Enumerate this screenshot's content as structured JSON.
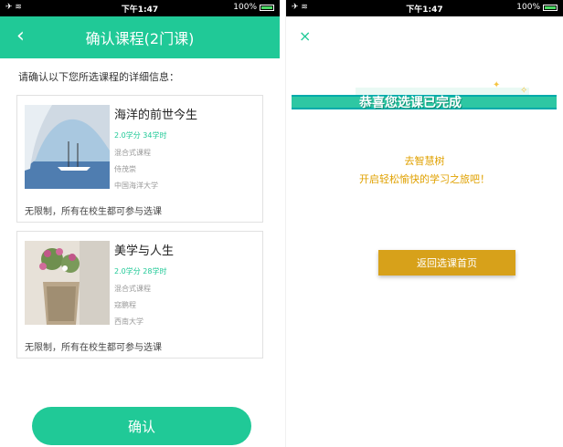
{
  "left": {
    "status": {
      "left": "✈ ≋",
      "time": "下午1:47",
      "battery": "100%"
    },
    "nav": {
      "back": "‹",
      "title": "确认课程(2门课)"
    },
    "intro": "请确认以下您所选课程的详细信息：",
    "courses": [
      {
        "name": "海洋的前世今生",
        "credits": "2.0学分",
        "hours": "34学时",
        "mode": "混合式课程",
        "teacher": "侍茂崇",
        "school": "中国海洋大学",
        "note": "无限制，所有在校生都可参与选课"
      },
      {
        "name": "美学与人生",
        "credits": "2.0学分",
        "hours": "28学时",
        "mode": "混合式课程",
        "teacher": "寇鹏程",
        "school": "西南大学",
        "note": "无限制，所有在校生都可参与选课"
      }
    ],
    "confirm": "确认"
  },
  "right": {
    "status": {
      "left": "✈ ≋",
      "time": "下午1:47",
      "battery": "100%"
    },
    "close": "×",
    "banner": "恭喜您选课已完成",
    "line1": "去智慧树",
    "line2": "开启轻松愉快的学习之旅吧！",
    "return_button": "返回选课首页"
  },
  "colors": {
    "accent": "#20c997",
    "gold": "#d7a11a",
    "message": "#e0a100"
  }
}
